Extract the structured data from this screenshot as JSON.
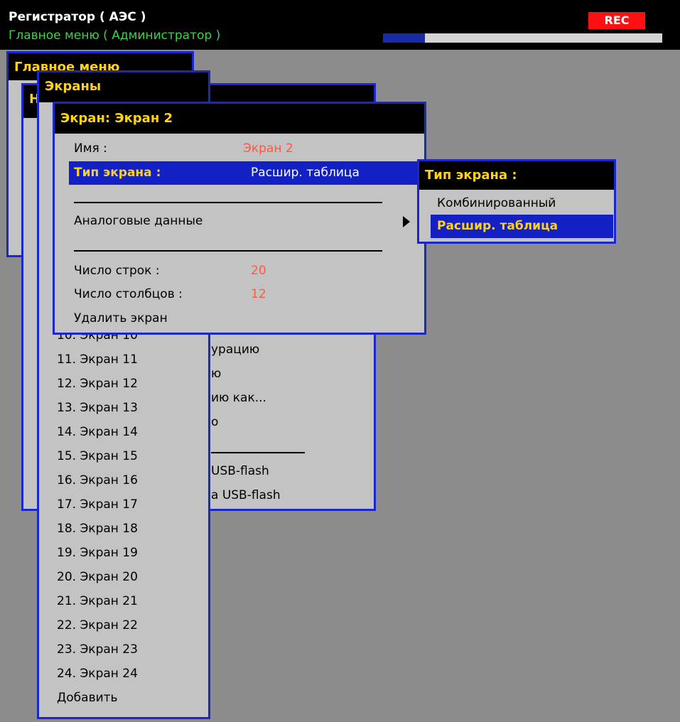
{
  "header": {
    "app_title": "Регистратор ( АЭС )",
    "subtitle": "Главное меню ( Администратор )",
    "rec_label": "REC",
    "progress": 0.15
  },
  "main_menu": {
    "title": "Главное меню"
  },
  "config_menu": {
    "title_fragment": "Н",
    "items": [
      "урацию",
      "ю",
      "ию как...",
      "о",
      "USB-flash",
      "а USB-flash"
    ]
  },
  "screens_menu": {
    "title": "Экраны",
    "items": [
      "10. Экран 10",
      "11. Экран 11",
      "12. Экран 12",
      "13. Экран 13",
      "14. Экран 14",
      "15. Экран 15",
      "16. Экран 16",
      "17. Экран 17",
      "18. Экран 18",
      "19. Экран 19",
      "20. Экран 20",
      "21. Экран 21",
      "22. Экран 22",
      "23. Экран 23",
      "24. Экран 24",
      "Добавить"
    ]
  },
  "screen_dialog": {
    "title": "Экран: Экран 2",
    "name_label": "Имя :",
    "name_value": "Экран 2",
    "type_label": "Тип экрана :",
    "type_value": "Расшир. таблица",
    "analog_label": "Аналоговые данные",
    "rows_label": "Число строк :",
    "rows_value": "20",
    "cols_label": "Число столбцов :",
    "cols_value": "12",
    "delete_label": "Удалить экран"
  },
  "type_popup": {
    "title": "Тип экрана :",
    "options": [
      "Комбинированный",
      "Расшир. таблица"
    ],
    "selected_index": 1
  },
  "colors": {
    "border": "#1c27c9",
    "selection": "#1220c4",
    "title_text": "#ffd21a",
    "value_text": "#ff5a3c",
    "rec": "#ff1010",
    "subtitle": "#3fd24a"
  }
}
